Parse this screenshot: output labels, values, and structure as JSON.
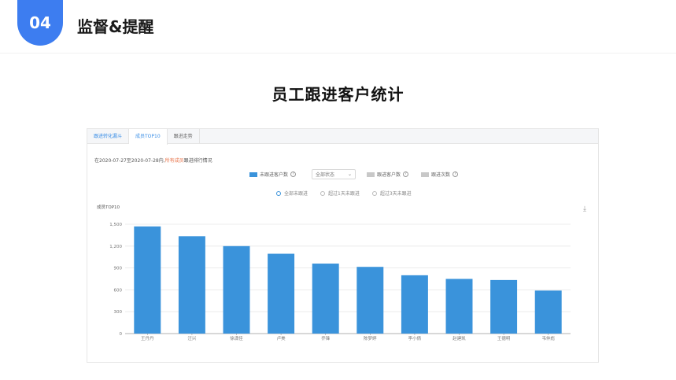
{
  "header": {
    "badge": "04",
    "title": "监督&提醒"
  },
  "main_title": "员工跟进客户统计",
  "panel": {
    "tabs": [
      {
        "label": "跟进转化漏斗",
        "active": false
      },
      {
        "label": "成员TOP10",
        "active": true
      },
      {
        "label": "跟进走势",
        "active": false
      }
    ],
    "range_prefix": "在2020-07-27至2020-07-28内,",
    "range_highlight": "所有成员",
    "range_suffix": "跟进排行情况",
    "legend": {
      "metric1": "未跟进客户数",
      "select_value": "全部状态",
      "metric2": "跟进客户数",
      "metric3": "跟进次数"
    },
    "radios": [
      {
        "label": "全部未跟进",
        "selected": true
      },
      {
        "label": "超过1天未跟进",
        "selected": false
      },
      {
        "label": "超过3天未跟进",
        "selected": false
      }
    ],
    "chart_caption": "成员TOP10",
    "download_icon": "download-icon"
  },
  "colors": {
    "accent": "#3d7df0",
    "bar": "#3a93db",
    "highlight": "#e8744a"
  },
  "chart_data": {
    "type": "bar",
    "title": "成员TOP10",
    "categories": [
      "王丹丹",
      "汪兴",
      "徐潇佳",
      "卢美",
      "乔锋",
      "陈梦婷",
      "李小倩",
      "赵建凯",
      "王德明",
      "韦仲彪"
    ],
    "values": [
      1470,
      1335,
      1200,
      1095,
      960,
      915,
      800,
      750,
      735,
      590
    ],
    "ylim": [
      0,
      1500
    ],
    "yticks": [
      "0",
      "300",
      "600",
      "900",
      "1,200",
      "1,500"
    ],
    "grid": true
  }
}
